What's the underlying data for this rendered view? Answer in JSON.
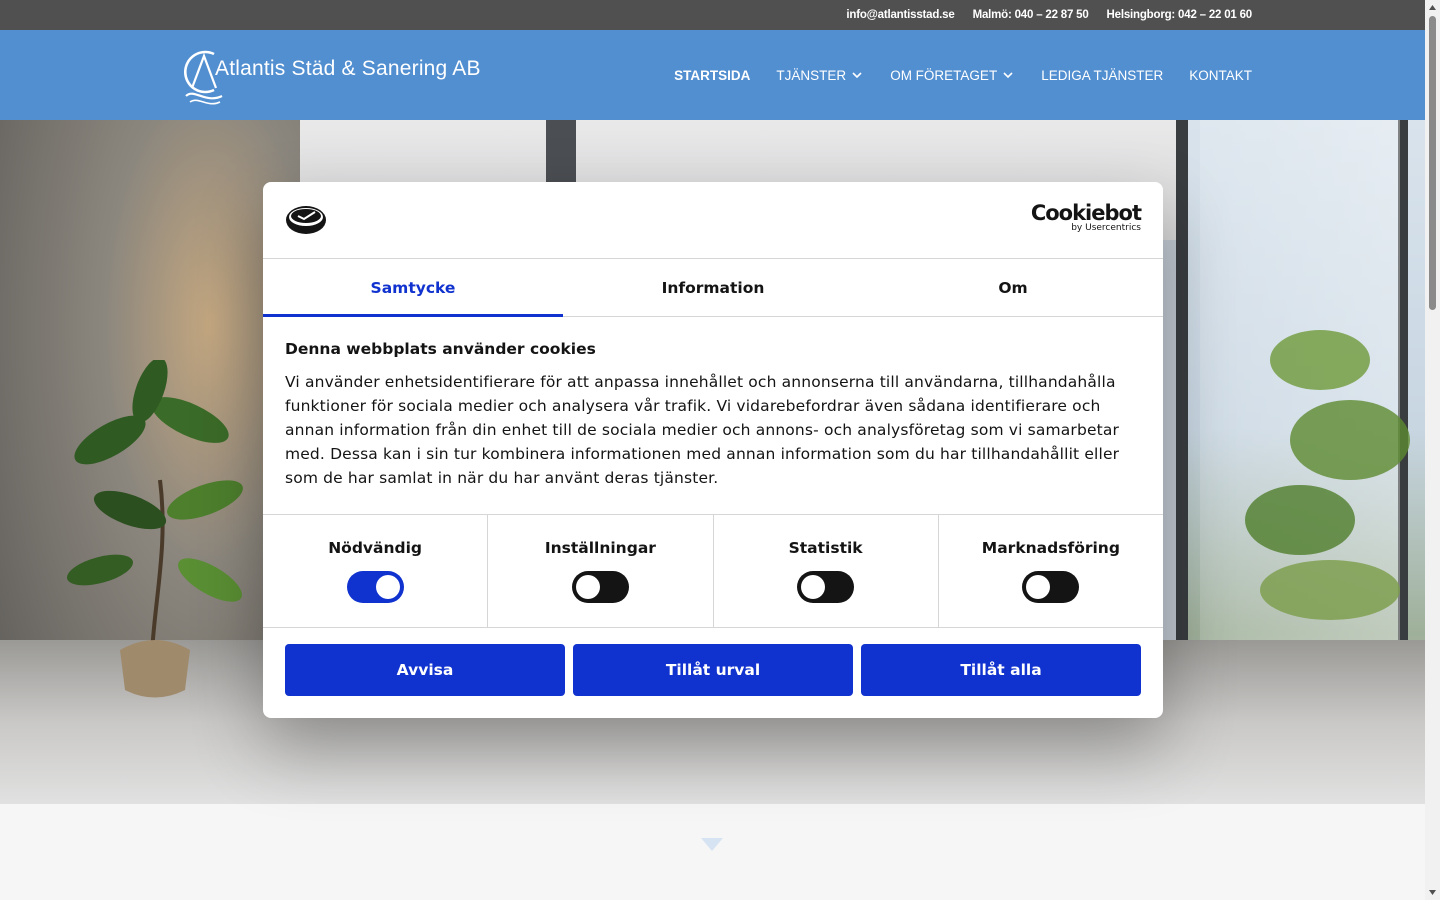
{
  "topbar": {
    "email": "info@atlantisstad.se",
    "malmo": "Malmö: 040 – 22 87 50",
    "helsingborg": "Helsingborg: 042 – 22 01 60"
  },
  "header": {
    "logo_text": "Atlantis Städ & Sanering AB",
    "nav": [
      {
        "label": "STARTSIDA",
        "active": true,
        "dropdown": false
      },
      {
        "label": "TJÄNSTER",
        "active": false,
        "dropdown": true
      },
      {
        "label": "OM FÖRETAGET",
        "active": false,
        "dropdown": true
      },
      {
        "label": "LEDIGA TJÄNSTER",
        "active": false,
        "dropdown": false
      },
      {
        "label": "KONTAKT",
        "active": false,
        "dropdown": false
      }
    ]
  },
  "cookie_dialog": {
    "brand_main": "Cookiebot",
    "brand_sub": "by Usercentrics",
    "tabs": [
      {
        "label": "Samtycke",
        "active": true
      },
      {
        "label": "Information",
        "active": false
      },
      {
        "label": "Om",
        "active": false
      }
    ],
    "title": "Denna webbplats använder cookies",
    "body": "Vi använder enhetsidentifierare för att anpassa innehållet och annonserna till användarna, tillhandahålla funktioner för sociala medier och analysera vår trafik. Vi vidarebefordrar även sådana identifierare och annan information från din enhet till de sociala medier och annons- och analysföretag som vi samarbetar med. Dessa kan i sin tur kombinera informationen med annan information som du har tillhandahållit eller som de har samlat in när du har använt deras tjänster.",
    "categories": [
      {
        "label": "Nödvändig",
        "enabled": true
      },
      {
        "label": "Inställningar",
        "enabled": false
      },
      {
        "label": "Statistik",
        "enabled": false
      },
      {
        "label": "Marknadsföring",
        "enabled": false
      }
    ],
    "buttons": {
      "deny": "Avvisa",
      "allow_selection": "Tillåt urval",
      "allow_all": "Tillåt alla"
    }
  },
  "colors": {
    "header_bg": "#528fd1",
    "topbar_bg": "#505050",
    "accent": "#1032cf"
  }
}
